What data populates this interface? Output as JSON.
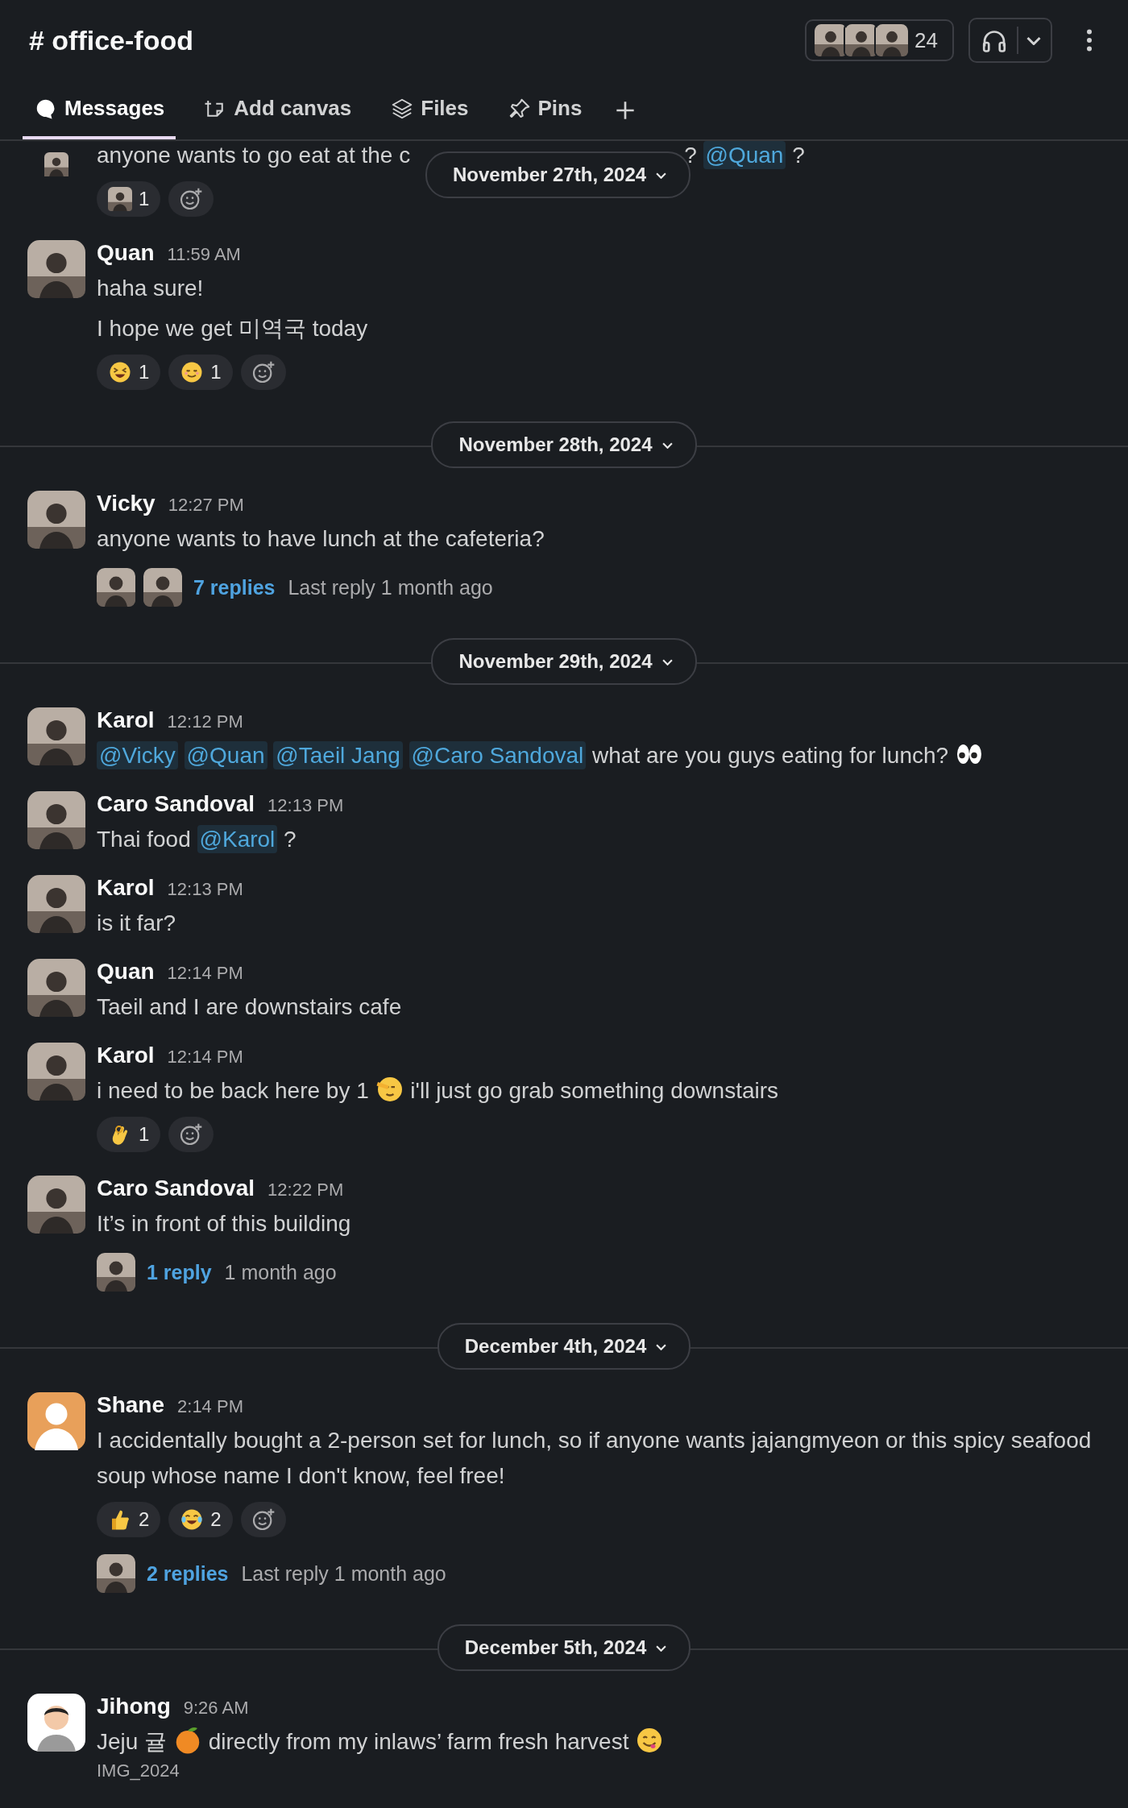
{
  "channel": {
    "title": "# office-food",
    "member_count": "24",
    "member_avatars": [
      {
        "kind": "photo"
      },
      {
        "kind": "photo"
      },
      {
        "kind": "photo"
      }
    ]
  },
  "tabs": [
    {
      "label": "Messages",
      "selected": true
    },
    {
      "label": "Add canvas",
      "selected": false
    },
    {
      "label": "Files",
      "selected": false
    },
    {
      "label": "Pins",
      "selected": false
    }
  ],
  "sticky_date": "November 27th, 2024",
  "feed": [
    {
      "kind": "message",
      "continued": true,
      "avatar": {
        "kind": "photo"
      },
      "lines": [
        [
          {
            "kind": "text",
            "text": "anyone wants to go eat at the c"
          },
          {
            "kind": "hidden"
          },
          {
            "kind": "text",
            "text": "?"
          },
          {
            "kind": "mention",
            "text": "@Quan"
          },
          {
            "kind": "text",
            "text": "?"
          }
        ]
      ],
      "reactions": [
        {
          "kind": "person",
          "count": "1"
        }
      ]
    },
    {
      "kind": "message",
      "author": "Quan",
      "time": "11:59 AM",
      "avatar": {
        "kind": "photo"
      },
      "lines": [
        [
          {
            "kind": "text",
            "text": "haha sure!"
          }
        ],
        [
          {
            "kind": "text",
            "text": "I hope we get 미역국 today"
          }
        ]
      ],
      "reactions": [
        {
          "kind": "laughing",
          "count": "1"
        },
        {
          "kind": "smiling",
          "count": "1"
        }
      ]
    },
    {
      "kind": "date",
      "label": "November 28th, 2024"
    },
    {
      "kind": "message",
      "author": "Vicky",
      "time": "12:27 PM",
      "avatar": {
        "kind": "photo"
      },
      "lines": [
        [
          {
            "kind": "text",
            "text": "anyone wants to have lunch at the cafeteria?"
          }
        ]
      ],
      "thread": {
        "avatars": [
          {
            "kind": "photo"
          },
          {
            "kind": "photo"
          }
        ],
        "replies": "7 replies",
        "meta": "Last reply 1 month ago"
      }
    },
    {
      "kind": "date",
      "label": "November 29th, 2024"
    },
    {
      "kind": "message",
      "author": "Karol",
      "time": "12:12 PM",
      "avatar": {
        "kind": "photo"
      },
      "lines": [
        [
          {
            "kind": "mention",
            "text": "@Vicky"
          },
          {
            "kind": "mention",
            "text": "@Quan"
          },
          {
            "kind": "mention",
            "text": "@Taeil Jang"
          },
          {
            "kind": "mention",
            "text": "@Caro Sandoval"
          },
          {
            "kind": "text",
            "text": "what are you guys eating for lunch?"
          },
          {
            "kind": "eyes"
          }
        ]
      ]
    },
    {
      "kind": "message",
      "author": "Caro Sandoval",
      "time": "12:13 PM",
      "avatar": {
        "kind": "photo"
      },
      "lines": [
        [
          {
            "kind": "text",
            "text": "Thai food"
          },
          {
            "kind": "mention",
            "text": "@Karol"
          },
          {
            "kind": "text",
            "text": "?"
          }
        ]
      ]
    },
    {
      "kind": "message",
      "author": "Karol",
      "time": "12:13 PM",
      "avatar": {
        "kind": "photo"
      },
      "lines": [
        [
          {
            "kind": "text",
            "text": "is it far?"
          }
        ]
      ]
    },
    {
      "kind": "message",
      "author": "Quan",
      "time": "12:14 PM",
      "avatar": {
        "kind": "photo"
      },
      "lines": [
        [
          {
            "kind": "text",
            "text": "Taeil and I are downstairs cafe"
          }
        ]
      ]
    },
    {
      "kind": "message",
      "author": "Karol",
      "time": "12:14 PM",
      "avatar": {
        "kind": "photo"
      },
      "lines": [
        [
          {
            "kind": "text",
            "text": "i need to be back here by 1"
          },
          {
            "kind": "saluting"
          },
          {
            "kind": "text",
            "text": "i'll just go grab something downstairs"
          }
        ]
      ],
      "reactions": [
        {
          "kind": "ok",
          "count": "1"
        }
      ]
    },
    {
      "kind": "message",
      "author": "Caro Sandoval",
      "time": "12:22 PM",
      "avatar": {
        "kind": "photo"
      },
      "lines": [
        [
          {
            "kind": "text",
            "text": "It’s in front of this building"
          }
        ]
      ],
      "thread": {
        "avatars": [
          {
            "kind": "photo"
          }
        ],
        "replies": "1 reply",
        "meta": "1 month ago"
      }
    },
    {
      "kind": "date",
      "label": "December 4th, 2024"
    },
    {
      "kind": "message",
      "author": "Shane",
      "time": "2:14 PM",
      "avatar": {
        "kind": "default"
      },
      "lines": [
        [
          {
            "kind": "text",
            "text": "I accidentally bought a 2-person set for lunch, so if anyone wants jajangmyeon or this spicy seafood soup whose name I don't know, feel free!"
          }
        ]
      ],
      "reactions": [
        {
          "kind": "thumbs",
          "count": "2"
        },
        {
          "kind": "joy",
          "count": "2"
        }
      ],
      "thread": {
        "avatars": [
          {
            "kind": "photo"
          }
        ],
        "replies": "2 replies",
        "meta": "Last reply 1 month ago"
      }
    },
    {
      "kind": "date",
      "label": "December 5th, 2024"
    },
    {
      "kind": "message",
      "author": "Jihong",
      "time": "9:26 AM",
      "avatar": {
        "kind": "cartoon"
      },
      "lines": [
        [
          {
            "kind": "text",
            "text": "Jeju 귤"
          },
          {
            "kind": "orange"
          },
          {
            "kind": "text",
            "text": "directly from my inlaws’ farm fresh harvest"
          },
          {
            "kind": "yum"
          }
        ]
      ],
      "file": "IMG_2024"
    }
  ]
}
